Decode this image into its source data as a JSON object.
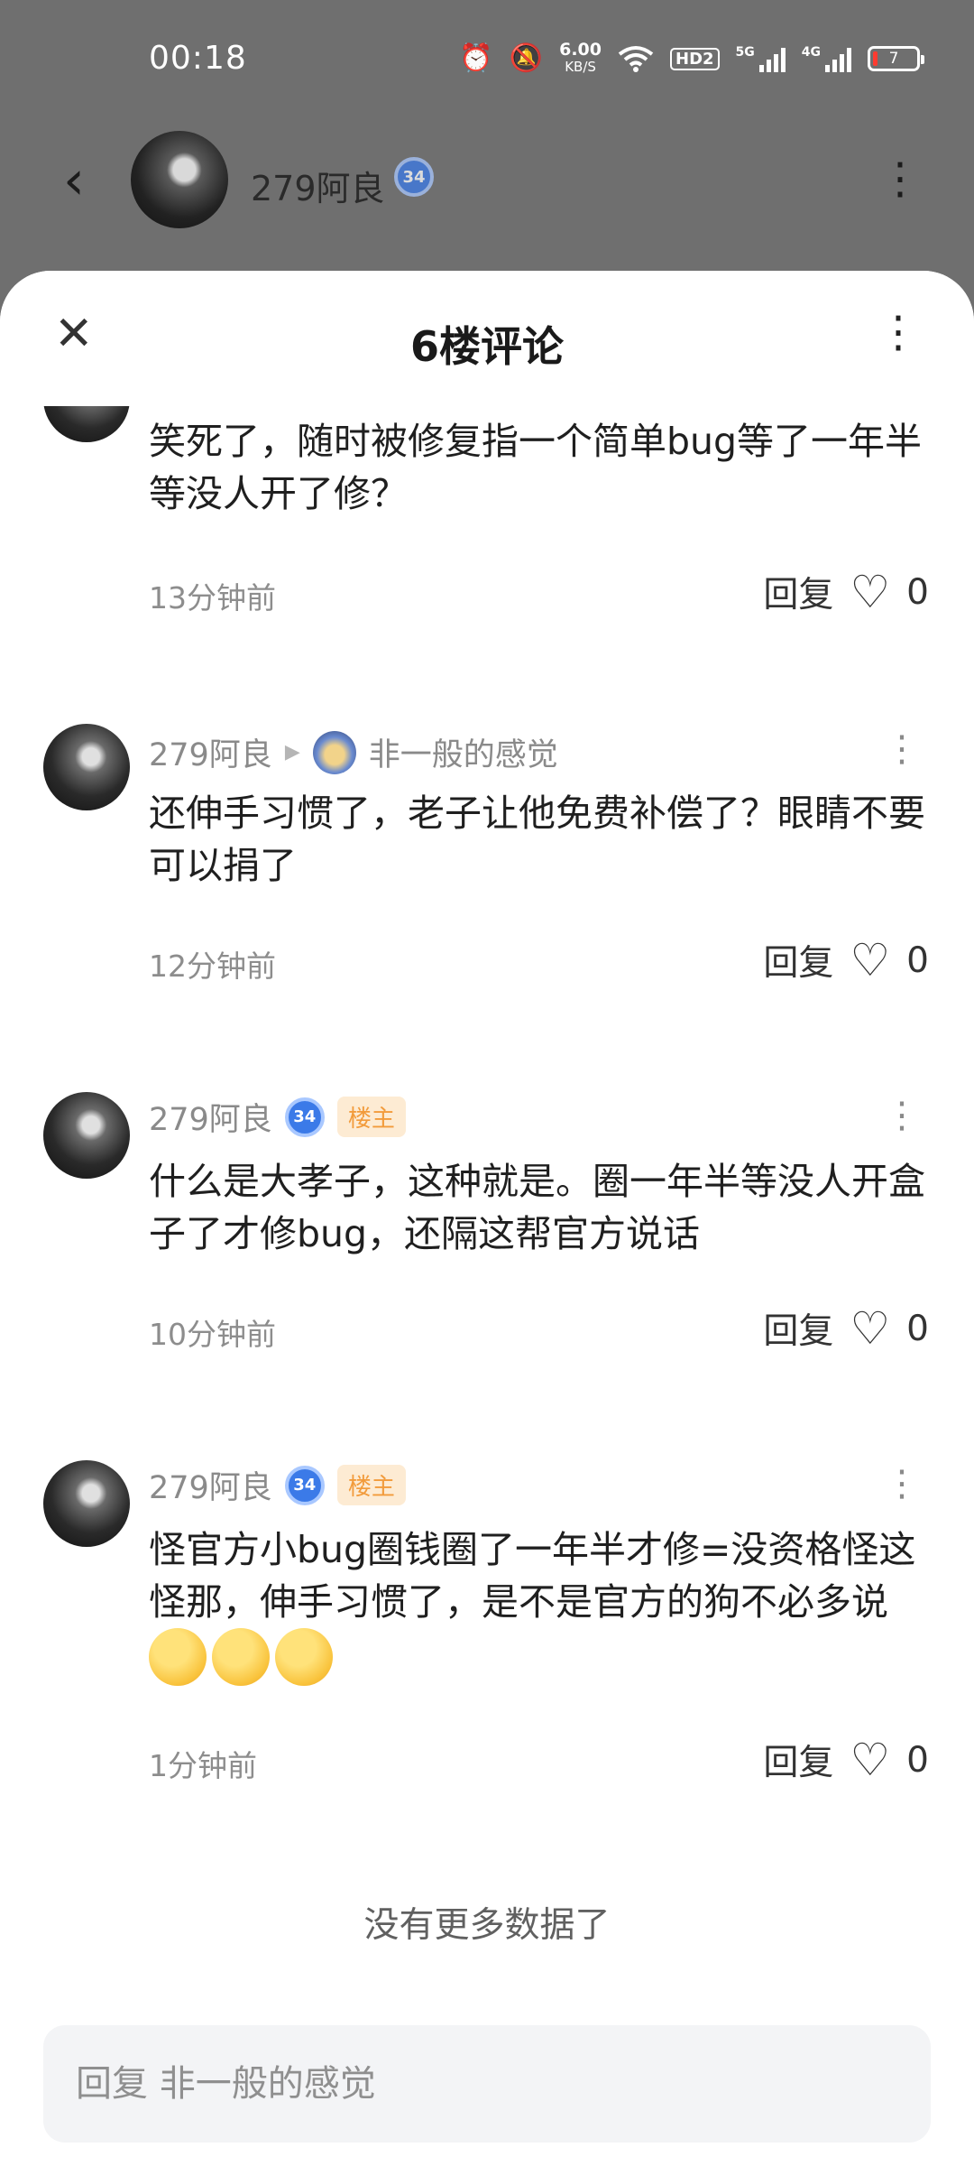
{
  "status_bar": {
    "time": "00:18",
    "net_speed": "6.00",
    "net_unit": "KB/S",
    "hd": "HD2",
    "sig1": "5G",
    "sig2": "4G",
    "battery": "7"
  },
  "page_header": {
    "author_name": "279阿良",
    "level": "34"
  },
  "sheet": {
    "title": "6楼评论"
  },
  "comments": [
    {
      "text": "笑死了，随时被修复指一个简单bug等了一年半等没人开了修？",
      "time": "13分钟前",
      "reply_label": "回复",
      "likes": "0"
    },
    {
      "author": "279阿良",
      "reply_to": "非一般的感觉",
      "text": "还伸手习惯了，老子让他免费补偿了？眼睛不要可以捐了",
      "time": "12分钟前",
      "reply_label": "回复",
      "likes": "0"
    },
    {
      "author": "279阿良",
      "level": "34",
      "tag": "楼主",
      "text": "什么是大孝子，这种就是。圈一年半等没人开盒子了才修bug，还隔这帮官方说话",
      "time": "10分钟前",
      "reply_label": "回复",
      "likes": "0"
    },
    {
      "author": "279阿良",
      "level": "34",
      "tag": "楼主",
      "text": "怪官方小bug圈钱圈了一年半才修=没资格怪这怪那，伸手习惯了，是不是官方的狗不必多说",
      "emojis": [
        "yawning-face-emoji",
        "yawning-face-emoji",
        "yawning-face-emoji"
      ],
      "time": "1分钟前",
      "reply_label": "回复",
      "likes": "0"
    }
  ],
  "footer": {
    "no_more": "没有更多数据了",
    "reply_placeholder": "回复 非一般的感觉"
  }
}
